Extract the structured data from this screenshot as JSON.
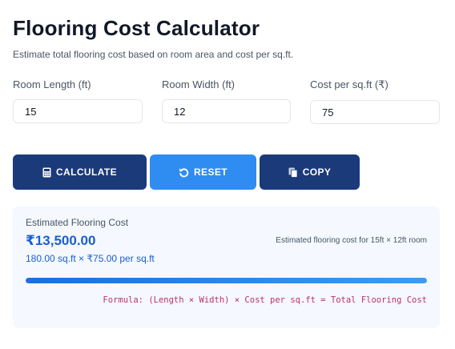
{
  "header": {
    "title": "Flooring Cost Calculator",
    "subtitle": "Estimate total flooring cost based on room area and cost per sq.ft."
  },
  "fields": {
    "length": {
      "label": "Room Length (ft)",
      "value": "15"
    },
    "width": {
      "label": "Room Width (ft)",
      "value": "12"
    },
    "cost": {
      "label": "Cost per sq.ft (₹)",
      "value": "75"
    }
  },
  "buttons": {
    "calculate": {
      "label": "CALCULATE",
      "icon": "calculator-icon"
    },
    "reset": {
      "label": "RESET",
      "icon": "reset-icon"
    },
    "copy": {
      "label": "COPY",
      "icon": "copy-icon"
    }
  },
  "result": {
    "label": "Estimated Flooring Cost",
    "amount": "₹13,500.00",
    "note": "Estimated flooring cost for 15ft × 12ft room",
    "calculation": "180.00 sq.ft × ₹75.00 per sq.ft",
    "progress_fraction": 1.0,
    "formula": "Formula: (Length × Width) × Cost per sq.ft = Total Flooring Cost"
  },
  "colors": {
    "primary": "#1b3a7a",
    "accent": "#2f8cf0",
    "result_text": "#1a5fd0",
    "formula_text": "#c0306b"
  }
}
